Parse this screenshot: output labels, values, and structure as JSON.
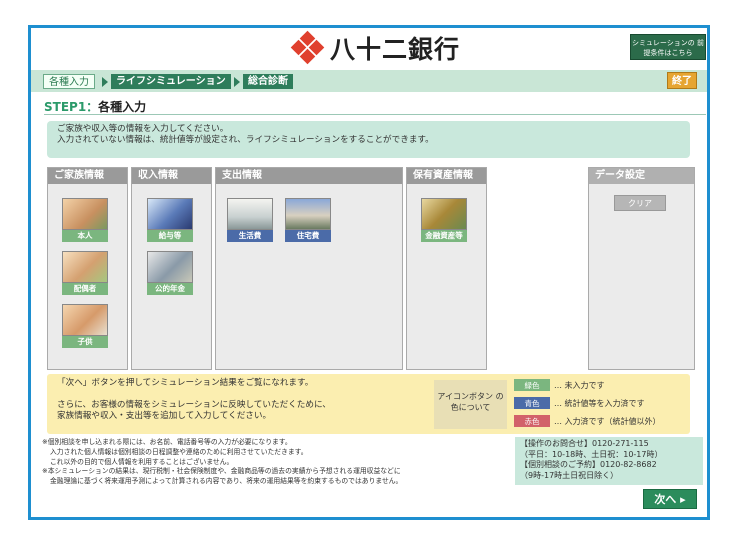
{
  "header": {
    "logo_text": "八十二銀行",
    "conditions_button": "シミュレーションの 前提条件はこちら"
  },
  "breadcrumb": {
    "items": [
      "各種入力",
      "ライフシミュレーション",
      "総合診断"
    ],
    "end_button": "終了"
  },
  "step": {
    "prefix": "STEP1：",
    "title": "各種入力"
  },
  "intro": {
    "line1": "ご家族や収入等の情報を入力してください。",
    "line2": "入力されていない情報は、統計値等が設定され、ライフシミュレーションをすることができます。"
  },
  "panels": {
    "family": {
      "title": "ご家族情報",
      "items": [
        "本人",
        "配偶者",
        "子供"
      ]
    },
    "income": {
      "title": "収入情報",
      "items": [
        "給与等",
        "公的年金"
      ]
    },
    "expense": {
      "title": "支出情報",
      "items": [
        "生活費",
        "住宅費"
      ]
    },
    "assets": {
      "title": "保有資産情報",
      "items": [
        "金融資産等"
      ]
    },
    "data": {
      "title": "データ設定",
      "clear_button": "クリア"
    }
  },
  "info": {
    "line1": "「次へ」ボタンを押してシミュレーション結果をご覧になれます。",
    "line2": "さらに、お客様の情報をシミュレーションに反映していただくために、",
    "line3": "家族情報や収入・支出等を追加して入力してください。"
  },
  "legend": {
    "head": "アイコンボタン の色について",
    "items": [
      {
        "label": "緑色",
        "desc": "… 未入力です",
        "color": "#7bb67f"
      },
      {
        "label": "青色",
        "desc": "… 統計値等を入力済です",
        "color": "#4b6ba8"
      },
      {
        "label": "赤色",
        "desc": "… 入力済です（統計値以外）",
        "color": "#d2626a"
      }
    ]
  },
  "notes": {
    "line1": "※個別相談を申し込まれる際には、お名前、電話番号等の入力が必要になります。",
    "line2": "入力された個人情報は個別相談の日程調整や連絡のために利用させていただきます。",
    "line3": "これ以外の目的で個人情報を利用することはございません。",
    "line4": "※本シミュレーションの結果は、現行税制・社会保険制度や、金融商品等の過去の実績から予想される運用収益などに",
    "line5": "金融理論に基づく将来運用予測によって計算される内容であり、将来の運用結果等を約束するものではありません。"
  },
  "contact": {
    "line1": "【操作のお問合せ】0120-271-115",
    "line2": "（平日：10-18時、土日祝：10-17時）",
    "line3": "【個別相談のご予約】0120-82-8682",
    "line4": "（9時-17時土日祝日除く）"
  },
  "next_button": "次へ ▸"
}
